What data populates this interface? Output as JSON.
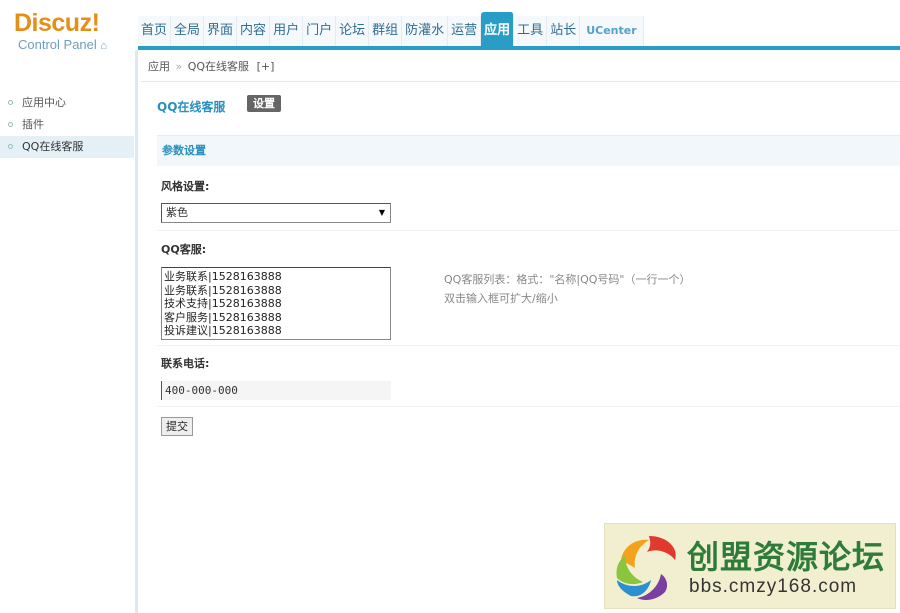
{
  "logo": {
    "brand": "Discuz!",
    "subtitle": "Control Panel"
  },
  "nav": {
    "items": [
      "首页",
      "全局",
      "界面",
      "内容",
      "用户",
      "门户",
      "论坛",
      "群组",
      "防灌水",
      "运营",
      "应用",
      "工具",
      "站长",
      "UCenter"
    ],
    "active": "应用"
  },
  "breadcrumb": {
    "parent": "应用",
    "separator": "»",
    "current": "QQ在线客服",
    "extra": "[+]"
  },
  "sidebar": {
    "items": [
      {
        "label": "应用中心"
      },
      {
        "label": "插件"
      },
      {
        "label": "QQ在线客服",
        "active": true
      }
    ]
  },
  "main": {
    "title": "QQ在线客服",
    "tab": "设置",
    "section": "参数设置",
    "style_label": "风格设置:",
    "style_value": "紫色",
    "qq_label": "QQ客服:",
    "qq_lines": [
      "业务联系|1528163888",
      "业务联系|1528163888",
      "技术支持|1528163888",
      "客户服务|1528163888",
      "投诉建议|1528163888"
    ],
    "qq_tip_1": "QQ客服列表：格式：\"名称|QQ号码\"（一行一个）",
    "qq_tip_2": "双击输入框可扩大/缩小",
    "phone_label": "联系电话:",
    "phone_value": "400-000-000",
    "submit_label": "提交"
  },
  "watermark": {
    "title": "创盟资源论坛",
    "url": "bbs.cmzy168.com"
  },
  "colors": {
    "accent": "#2a9dc6",
    "brand": "#e58f19",
    "link": "#2a8fbd"
  }
}
